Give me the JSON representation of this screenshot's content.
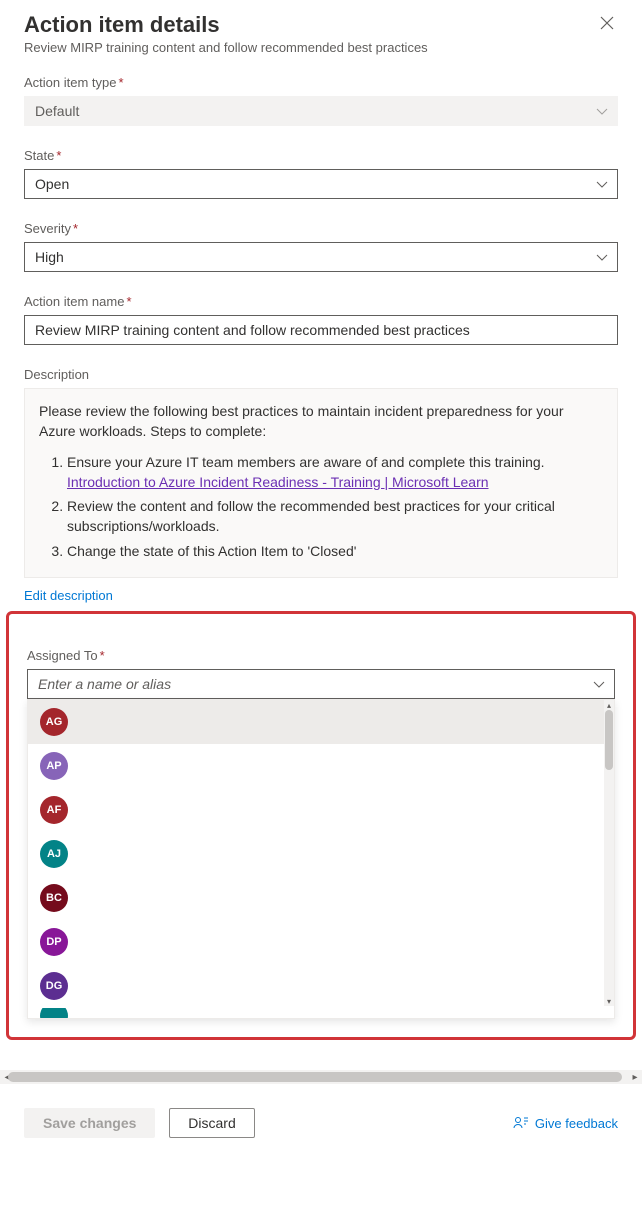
{
  "header": {
    "title": "Action item details",
    "subtitle": "Review MIRP training content and follow recommended best practices"
  },
  "fields": {
    "typeLabel": "Action item type",
    "typeValue": "Default",
    "stateLabel": "State",
    "stateValue": "Open",
    "severityLabel": "Severity",
    "severityValue": "High",
    "nameLabel": "Action item name",
    "nameValue": "Review MIRP training content and follow recommended best practices",
    "descriptionLabel": "Description",
    "descIntro": "Please review the following best practices to maintain incident preparedness for your Azure workloads. Steps to complete:",
    "descStep1": "Ensure your Azure IT team members are aware of and complete this training. ",
    "descStep1Link": "Introduction to Azure Incident Readiness - Training | Microsoft Learn",
    "descStep2": "Review the content and follow the recommended best practices for your critical subscriptions/workloads.",
    "descStep3": "Change the state of this Action Item to 'Closed'",
    "editLink": "Edit description",
    "assignedLabel": "Assigned To",
    "assignedPlaceholder": "Enter a name or alias"
  },
  "people": [
    {
      "initials": "AG",
      "color": "#a4262c"
    },
    {
      "initials": "AP",
      "color": "#8764b8"
    },
    {
      "initials": "AF",
      "color": "#a4262c"
    },
    {
      "initials": "AJ",
      "color": "#038387"
    },
    {
      "initials": "BC",
      "color": "#750b1c"
    },
    {
      "initials": "DP",
      "color": "#881798"
    },
    {
      "initials": "DG",
      "color": "#5c2e91"
    }
  ],
  "footer": {
    "save": "Save changes",
    "discard": "Discard",
    "feedback": "Give feedback"
  }
}
